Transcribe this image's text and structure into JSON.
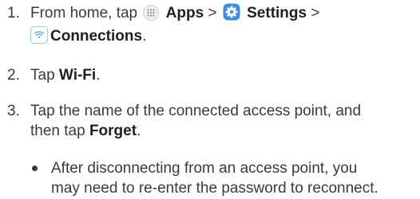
{
  "steps": [
    {
      "number": "1.",
      "prefix": "From home, tap",
      "apps_label": "Apps",
      "sep1": ">",
      "settings_label": "Settings",
      "sep2": ">",
      "connections_label": "Connections",
      "suffix": "."
    },
    {
      "number": "2.",
      "prefix": "Tap",
      "wifi_label": "Wi-Fi",
      "suffix": "."
    },
    {
      "number": "3.",
      "line1": "Tap the name of the connected access point, and",
      "line2_prefix": "then tap",
      "forget_label": "Forget",
      "suffix": "."
    }
  ],
  "bullet": {
    "line1": "After disconnecting from an access point, you",
    "line2": "may need to re-enter the password to reconnect."
  },
  "icons": {
    "apps": "apps-grid-icon",
    "settings": "settings-gear-icon",
    "connections": "connections-wifi-icon"
  },
  "colors": {
    "text": "#3a3a3a",
    "bold_text": "#1f1f1f",
    "settings_blue": "#3a8ee6",
    "connections_blue": "#5fb0e8"
  }
}
